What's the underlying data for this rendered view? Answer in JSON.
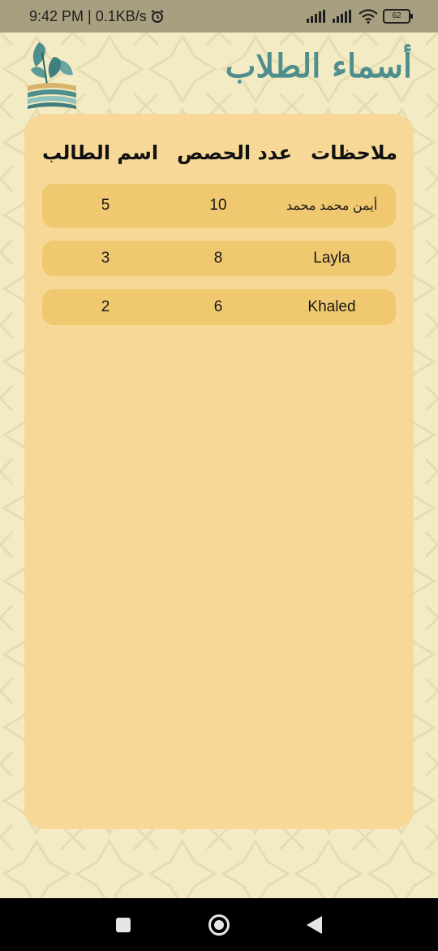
{
  "status_bar": {
    "time_speed": "9:42 PM | 0.1KB/s",
    "battery": "62"
  },
  "header": {
    "title": "أسماء الطلاب"
  },
  "table": {
    "columns": {
      "name": "اسم الطالب",
      "count": "عدد الحصص",
      "notes": "ملاحظات"
    },
    "rows": [
      {
        "name": "أيمن محمد محمد",
        "count": "10",
        "notes": "5"
      },
      {
        "name": "Layla",
        "count": "8",
        "notes": "3"
      },
      {
        "name": "Khaled",
        "count": "6",
        "notes": "2"
      }
    ]
  },
  "colors": {
    "background": "#f3ebc4",
    "card": "#f7d896",
    "row": "#f0c86f",
    "title": "#4e8f8e",
    "status_bar": "#a89f80"
  },
  "icons": [
    "alarm-icon",
    "signal-icon",
    "wifi-icon",
    "battery-icon",
    "logo-leaf-books-icon",
    "recents-icon",
    "home-icon",
    "back-icon"
  ]
}
